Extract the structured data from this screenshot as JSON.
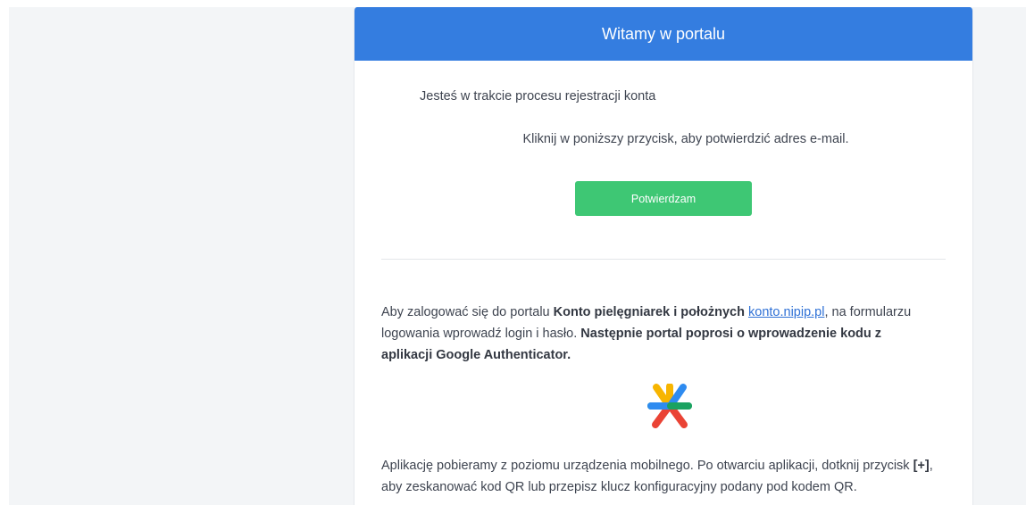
{
  "header": {
    "title": "Witamy w portalu"
  },
  "intro": {
    "text": "Jesteś w trakcie procesu rejestracji konta"
  },
  "instruction": {
    "text": "Kliknij w poniższy przycisk, aby potwierdzić adres e-mail."
  },
  "confirm_button": {
    "label": "Potwierdzam"
  },
  "login_info": {
    "part1": "Aby zalogować się do portalu ",
    "portal_name": "Konto pielęgniarek i położnych",
    "space": " ",
    "link_text": "konto.nipip.pl",
    "part2": ", na formularzu logowania wprowadź login i hasło. ",
    "part3_bold": "Następnie portal poprosi o wprowadzenie kodu z aplikacji Google Authenticator."
  },
  "app_info": {
    "part1": "Aplikację pobieramy z poziomu urządzenia mobilnego. Po otwarciu aplikacji, dotknij przycisk ",
    "plus_bold": "[+]",
    "part2": ", aby zeskanować kod QR lub przepisz klucz konfiguracyjny podany pod kodem QR."
  },
  "icons": {
    "authenticator": "google-authenticator-icon"
  },
  "colors": {
    "header_bg": "#347de0",
    "button_bg": "#3ec774",
    "link": "#2f71d6"
  }
}
